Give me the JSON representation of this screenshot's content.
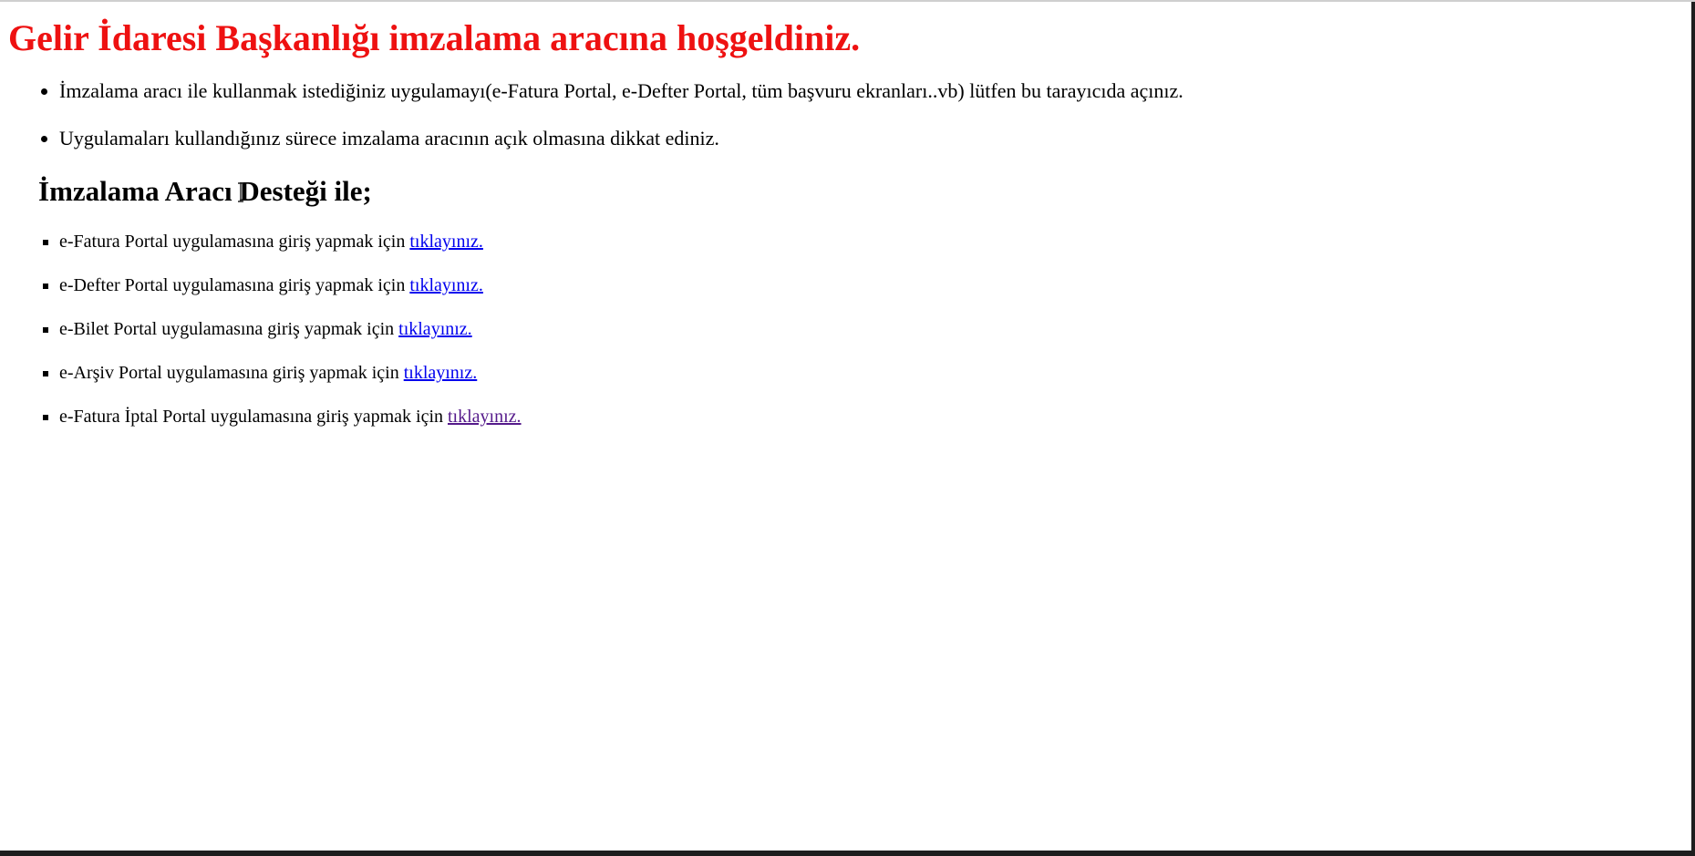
{
  "page": {
    "title": "Gelir İdaresi Başkanlığı imzalama aracına hoşgeldiniz.",
    "title_color": "#ee1111",
    "info_items": [
      "İmzalama aracı ile kullanmak istediğiniz uygulamayı(e-Fatura Portal, e-Defter Portal, tüm başvuru ekranları..vb) lütfen bu tarayıcıda açınız.",
      "Uygulamaları kullandığınız sürece imzalama aracının açık olmasına dikkat ediniz."
    ],
    "subtitle": "İmzalama Aracı Desteği ile;",
    "link_color": "#0000ee",
    "visited_link_color": "#551a8b",
    "link_items": [
      {
        "text": "e-Fatura Portal uygulamasına giriş yapmak için ",
        "link": "tıklayınız."
      },
      {
        "text": "e-Defter Portal uygulamasına giriş yapmak için ",
        "link": "tıklayınız."
      },
      {
        "text": "e-Bilet Portal uygulamasına giriş yapmak için ",
        "link": "tıklayınız."
      },
      {
        "text": "e-Arşiv Portal uygulamasına giriş yapmak için ",
        "link": "tıklayınız."
      },
      {
        "text": "e-Fatura İptal Portal uygulamasına giriş yapmak için ",
        "link": "tıklayınız."
      }
    ],
    "cursor_icon": "text-cursor-icon"
  }
}
